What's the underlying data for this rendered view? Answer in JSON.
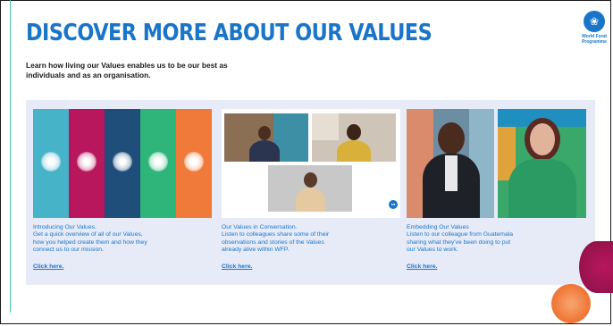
{
  "page": {
    "title": "DISCOVER MORE ABOUT OUR VALUES",
    "subtitle": "Learn how living our Values enables us to be our best as individuals and as an organisation."
  },
  "logo": {
    "line1": "World Food",
    "line2": "Programme",
    "icon": "wfp-emblem-icon"
  },
  "cards": [
    {
      "lines": [
        "Introducing Our Values.",
        "Get a quick overview of all of our Values,",
        "how you helped create them and how they",
        "connect us to our mission."
      ],
      "link": "Click here."
    },
    {
      "lines": [
        "Our Values in Conversation.",
        "Listen to colleagues share some of their",
        "observations and stories of the Values",
        "already alive within WFP."
      ],
      "link": "Click here."
    },
    {
      "lines": [
        "Embedding Our Values",
        "Listen to our colleague from Guatemala",
        "sharing what they've been doing to put",
        "our Values to work."
      ],
      "link": "Click here."
    }
  ],
  "colors": {
    "title": "#1a75c9",
    "panel": "#e7ebf7",
    "stripes": [
      "#46b3c9",
      "#b8175e",
      "#1f4e7a",
      "#2fb57a",
      "#f07a3a"
    ]
  }
}
